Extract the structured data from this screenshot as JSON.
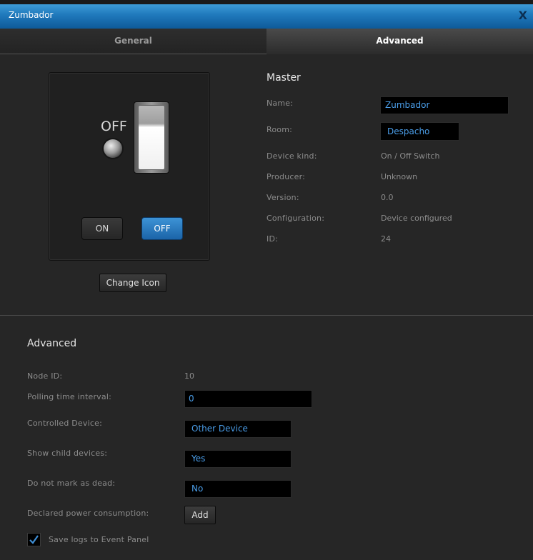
{
  "window": {
    "title": "Zumbador",
    "close_glyph": "X"
  },
  "tabs": [
    {
      "label": "General",
      "active": false
    },
    {
      "label": "Advanced",
      "active": true
    }
  ],
  "device_icon": {
    "state_label": "OFF",
    "on_button": "ON",
    "off_button": "OFF",
    "change_icon_button": "Change Icon"
  },
  "master": {
    "title": "Master",
    "name_label": "Name:",
    "name_value": "Zumbador",
    "room_label": "Room:",
    "room_value": "Despacho",
    "device_kind_label": "Device kind:",
    "device_kind_value": "On / Off Switch",
    "producer_label": "Producer:",
    "producer_value": "Unknown",
    "version_label": "Version:",
    "version_value": "0.0",
    "configuration_label": "Configuration:",
    "configuration_value": "Device configured",
    "id_label": "ID:",
    "id_value": "24"
  },
  "advanced": {
    "title": "Advanced",
    "node_id_label": "Node ID:",
    "node_id_value": "10",
    "polling_label": "Polling time interval:",
    "polling_value": "0",
    "controlled_device_label": "Controlled Device:",
    "controlled_device_value": "Other Device",
    "show_child_label": "Show child devices:",
    "show_child_value": "Yes",
    "not_dead_label": "Do not mark as dead:",
    "not_dead_value": "No",
    "power_label": "Declared power consumption:",
    "power_button": "Add",
    "save_logs_label": "Save logs to Event Panel",
    "save_logs_checked": true
  },
  "colors": {
    "accent": "#1f78bb",
    "field_text": "#4a9de8",
    "background": "#262626"
  }
}
